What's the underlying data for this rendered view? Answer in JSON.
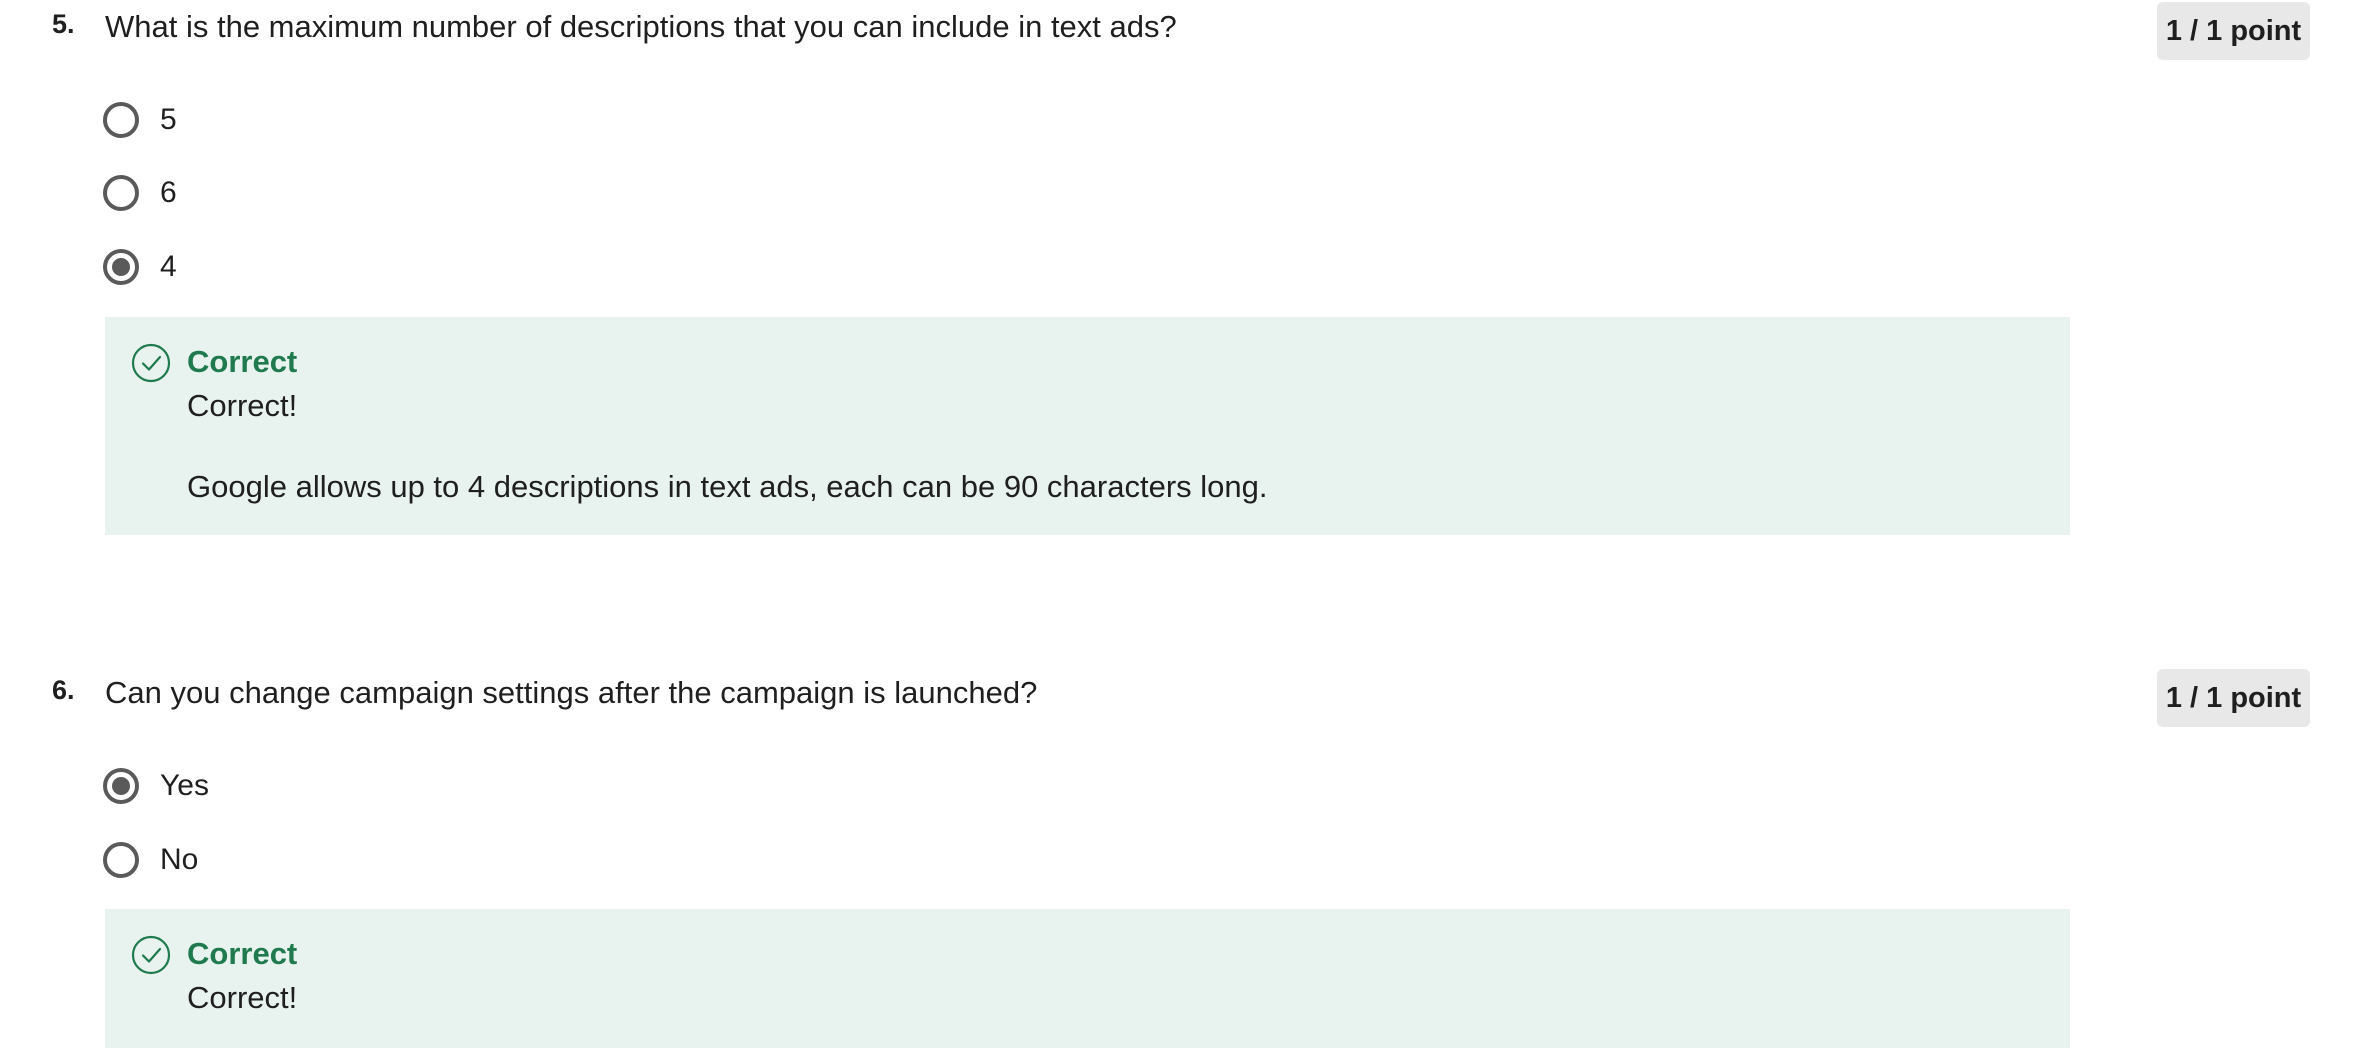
{
  "questions": [
    {
      "number": "5.",
      "text": "What is the maximum number of descriptions that you can include in text ads?",
      "points": "1 / 1 point",
      "options": [
        {
          "label": "5",
          "selected": false
        },
        {
          "label": "6",
          "selected": false
        },
        {
          "label": "4",
          "selected": true
        }
      ],
      "feedback": {
        "status": "Correct",
        "message": "Correct!",
        "explanation": "Google allows up to 4 descriptions in text ads, each can be 90 characters long."
      }
    },
    {
      "number": "6.",
      "text": "Can you change campaign settings after the campaign is launched?",
      "points": "1 / 1 point",
      "options": [
        {
          "label": "Yes",
          "selected": true
        },
        {
          "label": "No",
          "selected": false
        }
      ],
      "feedback": {
        "status": "Correct",
        "message": "Correct!"
      }
    }
  ],
  "colors": {
    "correct_green": "#1f7a4d",
    "feedback_bg": "#e8f2ee",
    "badge_bg": "#e8e8e8",
    "radio": "#5a5a5a"
  },
  "icons": {
    "feedback": "check-circle-icon"
  }
}
